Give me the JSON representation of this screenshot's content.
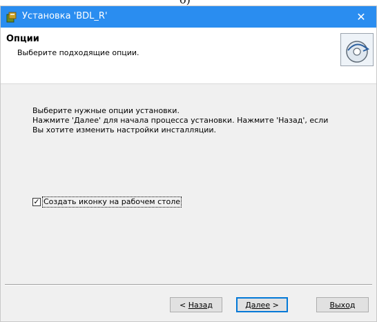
{
  "top_fragment": "б)",
  "window": {
    "title": "Установка 'BDL_R'",
    "close_glyph": "✕"
  },
  "header": {
    "title": "Опции",
    "subtitle": "Выберите подходящие опции.",
    "icon": "setup-disc-icon"
  },
  "content": {
    "lines": [
      "Выберите нужные опции установки.",
      "Нажмите 'Далее' для начала процесса установки. Нажмите 'Назад', если",
      "Вы хотите изменить настройки инсталляции."
    ],
    "checkbox": {
      "label": "Создать иконку на рабочем столе",
      "checked": true
    }
  },
  "buttons": {
    "back": {
      "prefix": "< ",
      "label": "Назад"
    },
    "next": {
      "label": "Далее",
      "suffix": " >"
    },
    "exit": {
      "label": "Выход"
    }
  },
  "colors": {
    "titlebar": "#2a8df0",
    "dialog_bg": "#f0f0f0",
    "default_button_border": "#0078d7"
  }
}
